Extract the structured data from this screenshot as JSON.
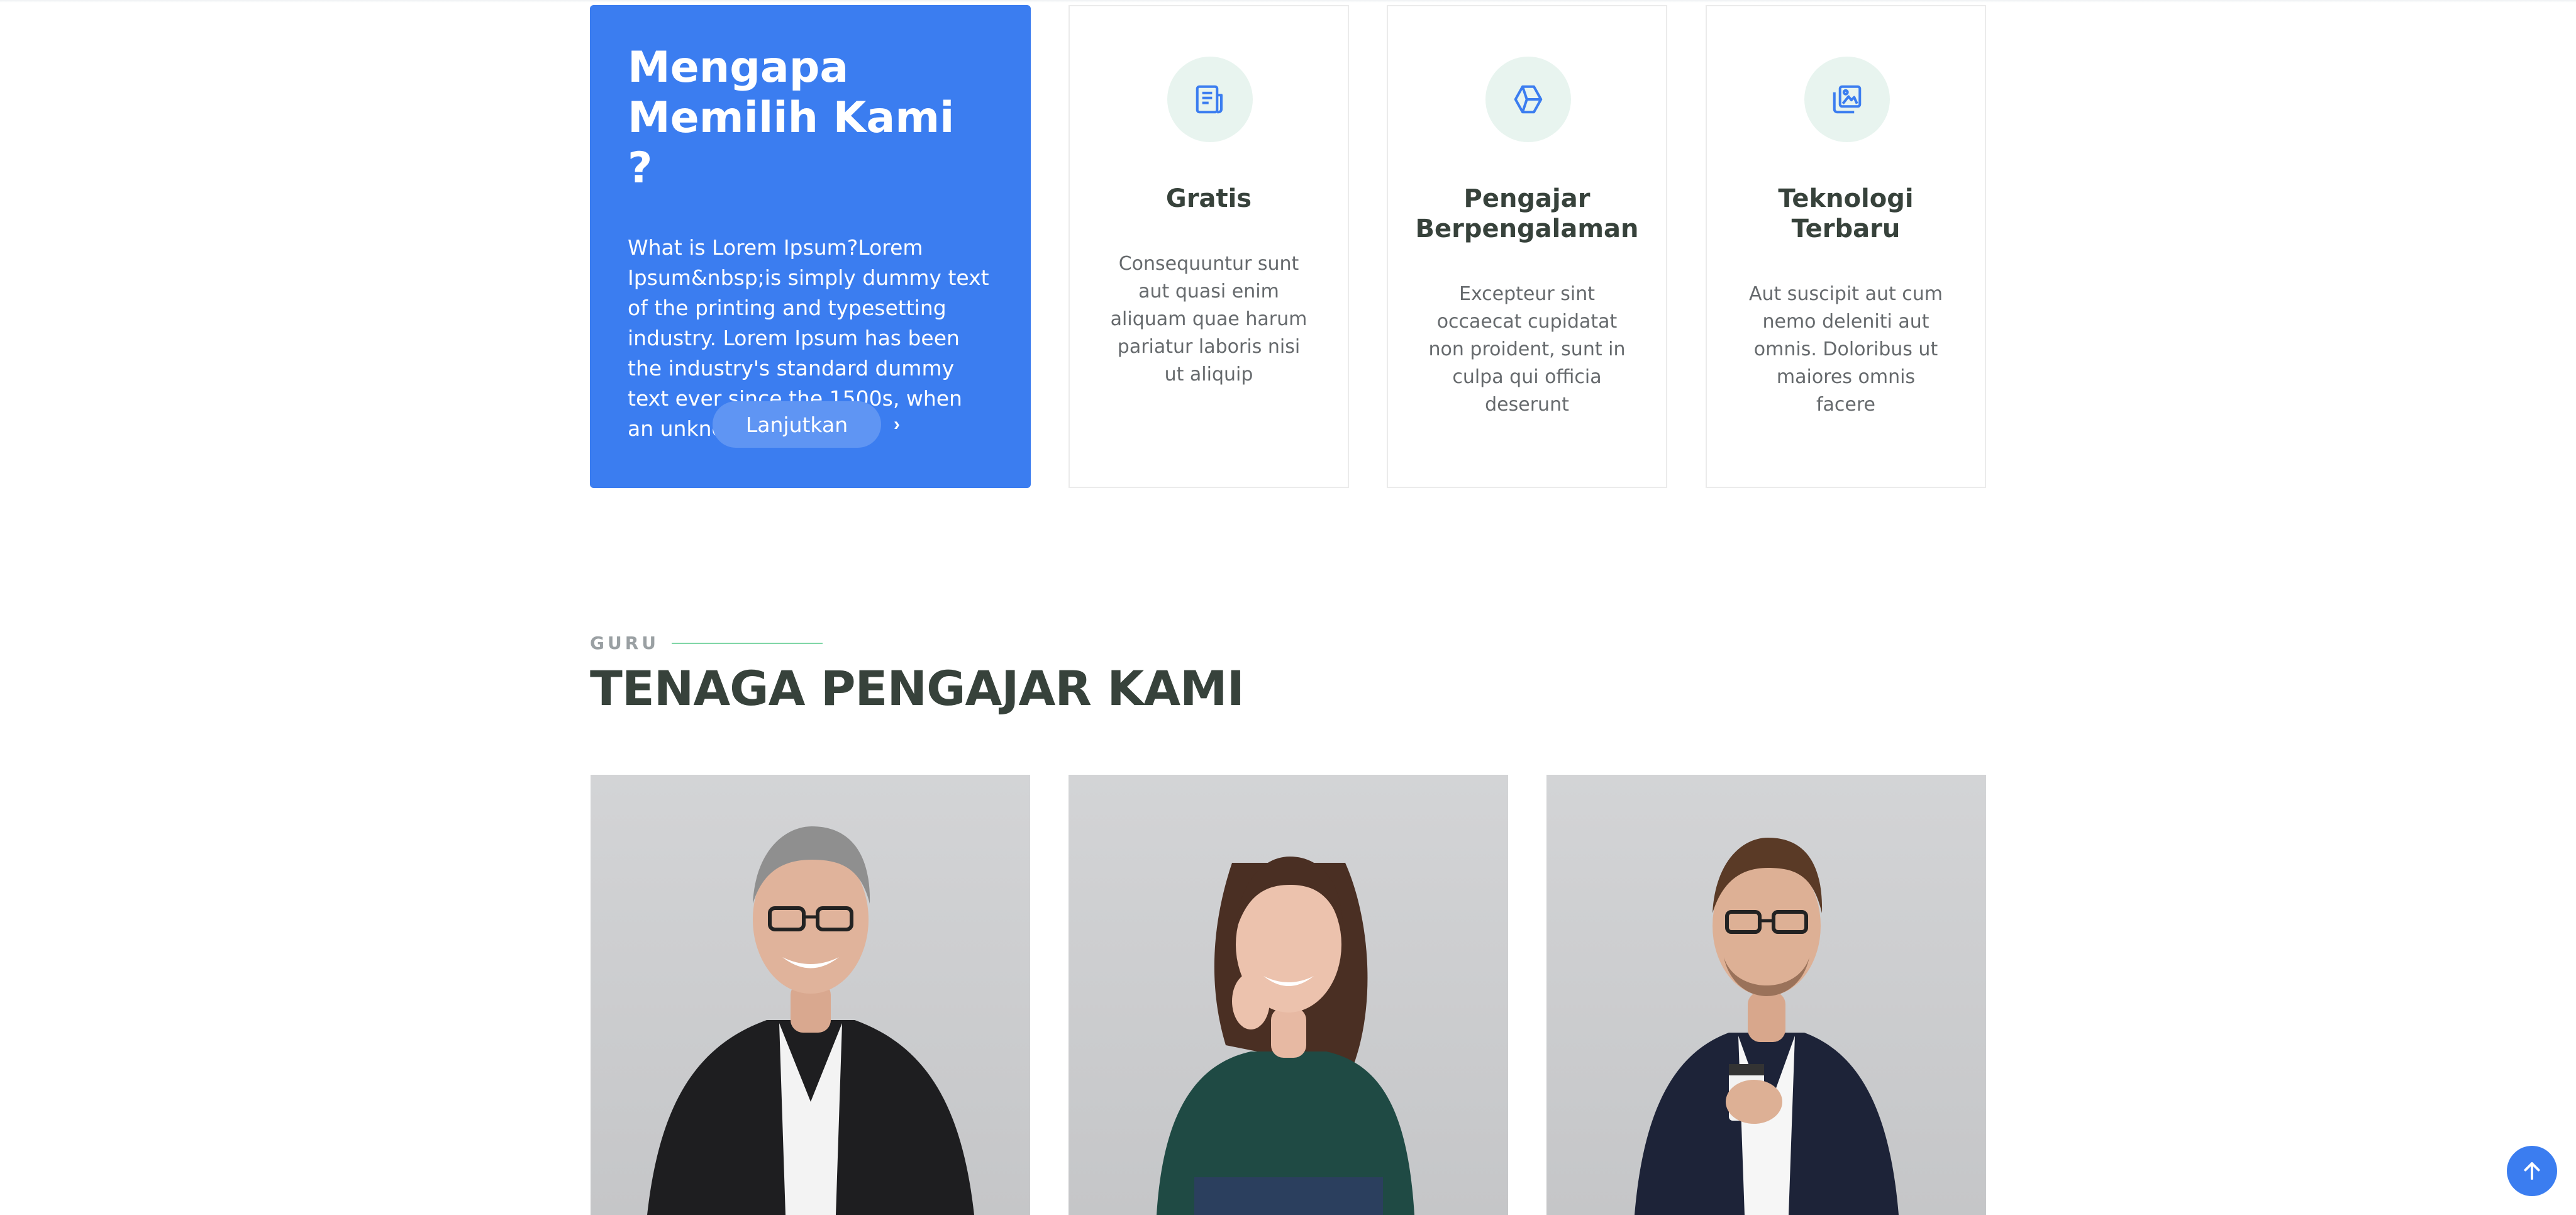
{
  "why": {
    "title_line1": "Mengapa",
    "title_line2": "Memilih Kami ?",
    "text": "What is Lorem Ipsum?Lorem Ipsum&nbsp;is simply dummy text of the printing and typesetting industry. Lorem Ipsum has been the industry's standard dummy text ever since the 1500s, when an unknown printe",
    "button_label": "Lanjutkan",
    "button_icon": "chevron-right-icon",
    "card_color": "#3b7df0"
  },
  "features": [
    {
      "icon": "newspaper-icon",
      "title": "Gratis",
      "title_line2": "",
      "description": "Consequuntur sunt aut quasi enim aliquam quae harum pariatur laboris nisi ut aliquip"
    },
    {
      "icon": "cube-icon",
      "title": "Pengajar",
      "title_line2": "Berpengalaman",
      "description": "Excepteur sint occaecat cupidatat non proident, sunt in culpa qui officia deserunt"
    },
    {
      "icon": "images-icon",
      "title": "Teknologi",
      "title_line2": "Terbaru",
      "description": "Aut suscipit aut cum nemo deleniti aut omnis. Doloribus ut maiores omnis facere"
    }
  ],
  "teachers_section": {
    "label": "GURU",
    "title": "TENAGA PENGAJAR KAMI"
  },
  "teachers": [
    {
      "photo": "teacher-photo-man-gray-hair"
    },
    {
      "photo": "teacher-photo-woman-green-shirt"
    },
    {
      "photo": "teacher-photo-man-navy-blazer"
    }
  ],
  "back_to_top_icon": "arrow-up-icon",
  "accent_color": "#3b7df0",
  "icon_bg_color": "#e8f4ef"
}
